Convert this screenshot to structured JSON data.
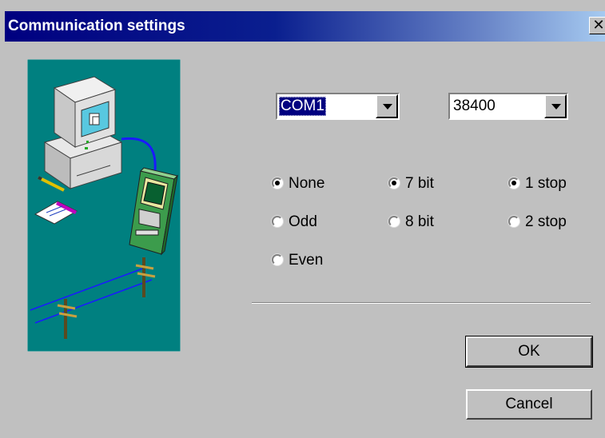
{
  "window": {
    "title": "Communication settings",
    "close_icon": "close-icon"
  },
  "port": {
    "value": "COM1"
  },
  "baud": {
    "value": "38400"
  },
  "parity": [
    {
      "label": "None",
      "checked": true
    },
    {
      "label": "Odd",
      "checked": false
    },
    {
      "label": "Even",
      "checked": false
    }
  ],
  "data_bits": [
    {
      "label": "7 bit",
      "checked": true
    },
    {
      "label": "8 bit",
      "checked": false
    }
  ],
  "stop_bits": [
    {
      "label": "1 stop",
      "checked": true
    },
    {
      "label": "2 stop",
      "checked": false
    }
  ],
  "buttons": {
    "ok": "OK",
    "cancel": "Cancel"
  },
  "colors": {
    "title_bar": "#000080",
    "illustration_bg": "#008080",
    "face": "#c0c0c0"
  }
}
